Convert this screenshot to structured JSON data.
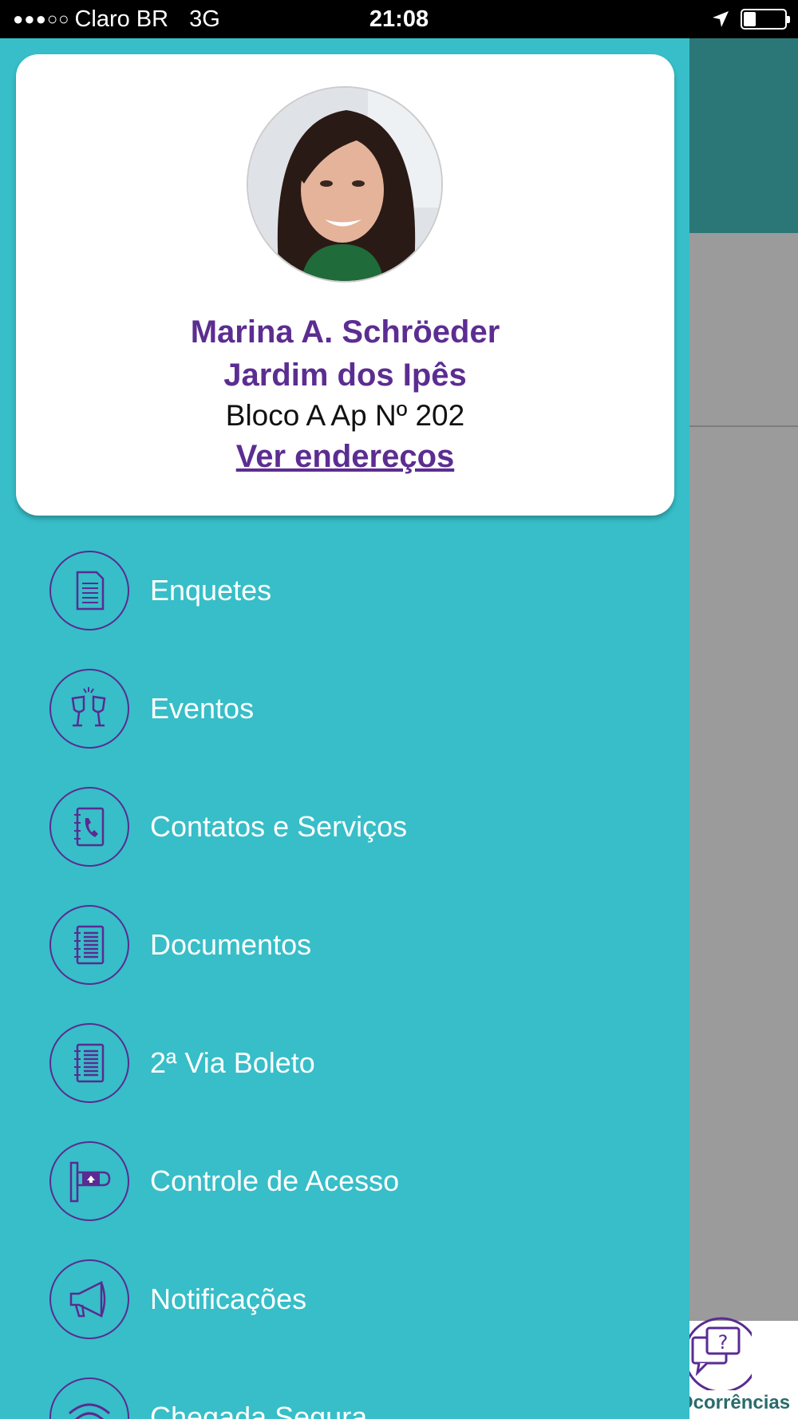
{
  "status_bar": {
    "signal": "●●●○○",
    "carrier": "Claro BR",
    "network": "3G",
    "time": "21:08",
    "battery_level": 0.3
  },
  "profile": {
    "name": "Marina A. Schröeder",
    "condominium": "Jardim dos Ipês",
    "unit": "Bloco A Ap Nº 202",
    "addresses_link": "Ver endereços"
  },
  "menu": {
    "items": [
      {
        "label": "Enquetes",
        "icon": "survey-document-icon"
      },
      {
        "label": "Eventos",
        "icon": "champagne-glasses-icon"
      },
      {
        "label": "Contatos e Serviços",
        "icon": "phone-book-icon"
      },
      {
        "label": "Documentos",
        "icon": "documents-icon"
      },
      {
        "label": "2ª Via Boleto",
        "icon": "invoice-icon"
      },
      {
        "label": "Controle de Acesso",
        "icon": "access-gate-icon"
      },
      {
        "label": "Notificações",
        "icon": "megaphone-icon"
      },
      {
        "label": "Chegada Segura",
        "icon": "wifi-icon"
      }
    ]
  },
  "background_tabbar": {
    "occurrences_label": "Ocorrências",
    "occurrences_icon": "question-chat-icon"
  },
  "colors": {
    "drawer_bg": "#37bec8",
    "accent_purple": "#5c2d91",
    "header_teal": "#2b7677"
  }
}
